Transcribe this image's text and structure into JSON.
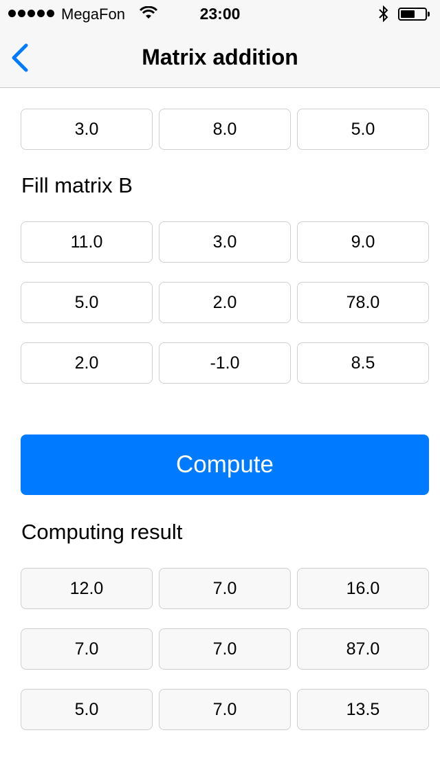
{
  "status_bar": {
    "carrier": "MegaFon",
    "time": "23:00",
    "signal_icon": "signal-dots-icon",
    "wifi_icon": "wifi-icon",
    "bluetooth_icon": "bluetooth-icon",
    "battery_icon": "battery-icon",
    "battery_level": 0.5
  },
  "nav": {
    "title": "Matrix addition",
    "back_icon": "chevron-left-icon"
  },
  "matrix_a": {
    "visible_last_row": [
      "3.0",
      "8.0",
      "5.0"
    ]
  },
  "matrix_b": {
    "heading": "Fill matrix B",
    "rows": [
      [
        "11.0",
        "3.0",
        "9.0"
      ],
      [
        "5.0",
        "2.0",
        "78.0"
      ],
      [
        "2.0",
        "-1.0",
        "8.5"
      ]
    ]
  },
  "compute_button": {
    "label": "Compute",
    "color": "#007aff"
  },
  "result": {
    "heading": "Computing result",
    "rows": [
      [
        "12.0",
        "7.0",
        "16.0"
      ],
      [
        "7.0",
        "7.0",
        "87.0"
      ],
      [
        "5.0",
        "7.0",
        "13.5"
      ]
    ]
  }
}
